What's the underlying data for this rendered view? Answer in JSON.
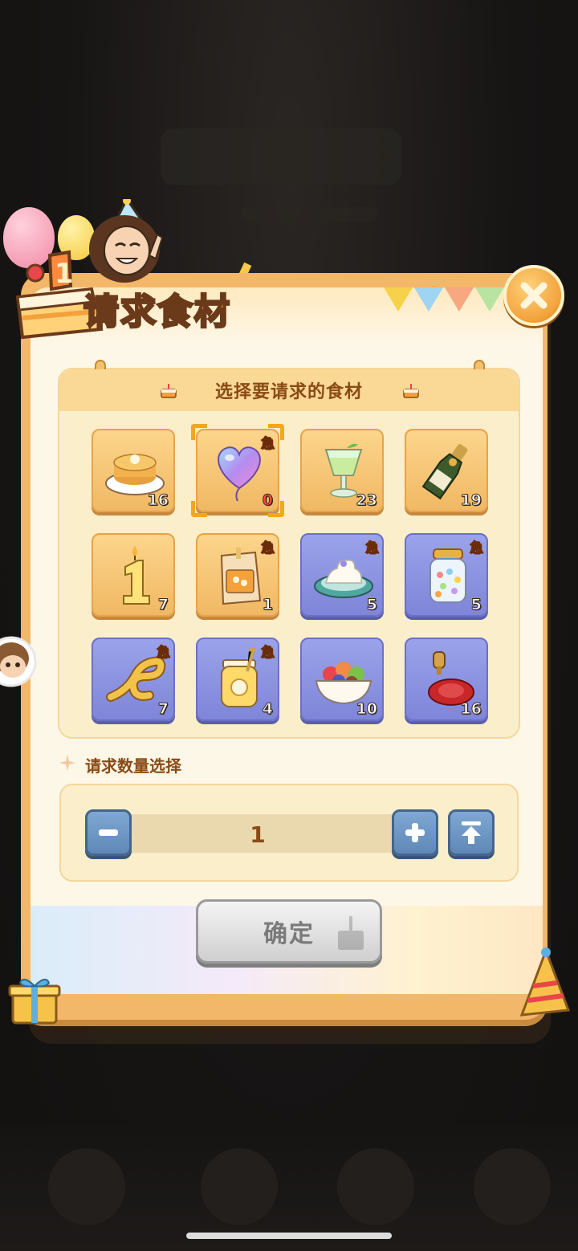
{
  "dialog": {
    "title": "请求食材",
    "header_badge": "1"
  },
  "ingredients": {
    "section_title": "选择要请求的食材",
    "urgent_label": "急",
    "items": [
      {
        "icon": "pancake-icon",
        "count": "16",
        "urgent": false,
        "style": "gold",
        "selected": false
      },
      {
        "icon": "heart-balloon-icon",
        "count": "0",
        "urgent": true,
        "style": "gold",
        "selected": true
      },
      {
        "icon": "jelly-drink-icon",
        "count": "23",
        "urgent": false,
        "style": "gold",
        "selected": false
      },
      {
        "icon": "champagne-bottle-icon",
        "count": "19",
        "urgent": false,
        "style": "gold",
        "selected": false
      },
      {
        "icon": "number-one-candle-icon",
        "count": "7",
        "urgent": false,
        "style": "gold",
        "selected": false
      },
      {
        "icon": "food-bag-icon",
        "count": "1",
        "urgent": true,
        "style": "gold",
        "selected": false
      },
      {
        "icon": "cream-plate-icon",
        "count": "5",
        "urgent": true,
        "style": "purple",
        "selected": false
      },
      {
        "icon": "candy-jar-icon",
        "count": "5",
        "urgent": true,
        "style": "purple",
        "selected": false
      },
      {
        "icon": "gold-ribbon-icon",
        "count": "7",
        "urgent": true,
        "style": "purple",
        "selected": false
      },
      {
        "icon": "honey-jar-icon",
        "count": "4",
        "urgent": true,
        "style": "purple",
        "selected": false
      },
      {
        "icon": "fruit-bowl-icon",
        "count": "10",
        "urgent": false,
        "style": "purple",
        "selected": false
      },
      {
        "icon": "wax-seal-icon",
        "count": "16",
        "urgent": false,
        "style": "purple",
        "selected": false
      }
    ]
  },
  "quantity": {
    "label": "请求数量选择",
    "value": "1"
  },
  "confirm": {
    "label": "确定"
  },
  "colors": {
    "panel": "#fdf7e7",
    "tile_gold": "#f0b864",
    "tile_purple": "#7f85d8",
    "title_orange": "#ff8a3d",
    "text_brown": "#8a4a16",
    "urgent_yellow": "#ffd34a"
  }
}
